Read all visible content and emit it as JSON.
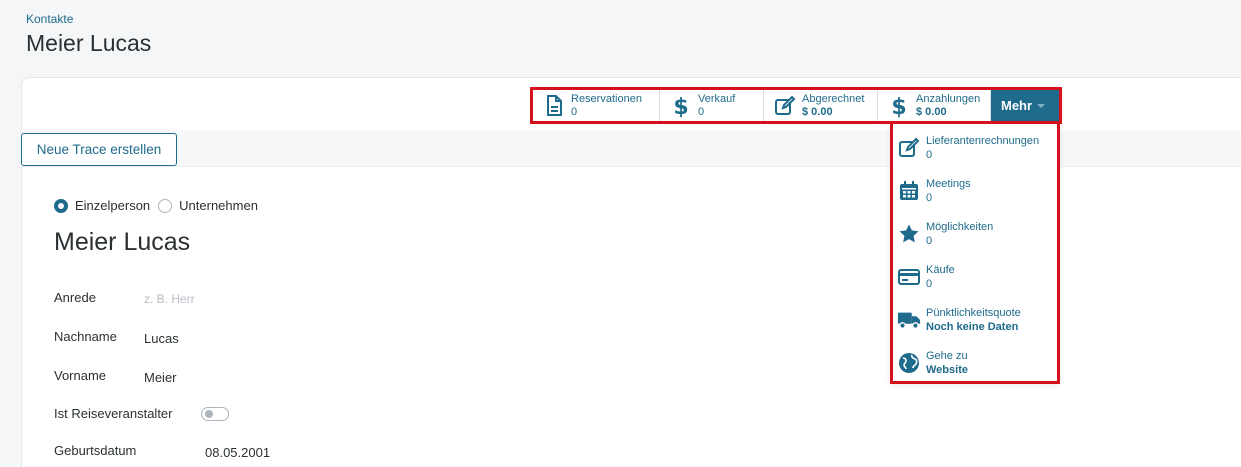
{
  "breadcrumb": "Kontakte",
  "page_title": "Meier Lucas",
  "colors": {
    "accent": "#1f6b8c",
    "highlight": "#d7101d"
  },
  "smart_buttons": [
    {
      "icon": "document-icon",
      "label": "Reservationen",
      "value": "0"
    },
    {
      "icon": "dollar-icon",
      "label": "Verkauf",
      "value": "0"
    },
    {
      "icon": "edit-icon",
      "label": "Abgerechnet",
      "value": "$ 0.00"
    },
    {
      "icon": "dollar-icon",
      "label": "Anzahlungen",
      "value": "$ 0.00"
    }
  ],
  "more_button": "Mehr",
  "dropdown_items": [
    {
      "icon": "edit-icon",
      "label": "Lieferantenrechnungen",
      "value": "0"
    },
    {
      "icon": "calendar-icon",
      "label": "Meetings",
      "value": "0"
    },
    {
      "icon": "star-icon",
      "label": "Möglichkeiten",
      "value": "0"
    },
    {
      "icon": "credit-card-icon",
      "label": "Käufe",
      "value": "0"
    },
    {
      "icon": "truck-icon",
      "label": "Pünktlichkeitsquote",
      "value": "Noch keine Daten"
    },
    {
      "icon": "globe-icon",
      "label": "Gehe zu",
      "value": "Website"
    }
  ],
  "trace_button": "Neue Trace erstellen",
  "radio": {
    "option1": "Einzelperson",
    "option2": "Unternehmen",
    "selected": "Einzelperson"
  },
  "form": {
    "name": "Meier Lucas",
    "anrede_label": "Anrede",
    "anrede_placeholder": "z. B. Herr",
    "nachname_label": "Nachname",
    "nachname_value": "Lucas",
    "vorname_label": "Vorname",
    "vorname_value": "Meier",
    "reiseveranstalter_label": "Ist Reiseveranstalter",
    "reiseveranstalter_enabled": false,
    "geburtsdatum_label": "Geburtsdatum",
    "geburtsdatum_value": "08.05.2001"
  }
}
